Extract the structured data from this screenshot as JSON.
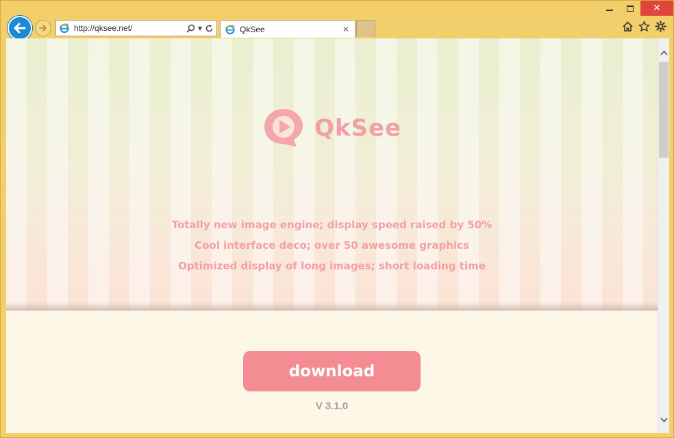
{
  "browser": {
    "address": "http://qksee.net/",
    "tab_title": "QkSee",
    "tab_close": "✕",
    "window": {
      "minimize": "minimize",
      "maximize": "maximize",
      "close": "✕"
    }
  },
  "page": {
    "logo_text": "QkSee",
    "features": [
      "Totally new image engine; display speed raised by 50%",
      "Cool interface deco; over 50 awesome graphics",
      "Optimized display of long images; short loading time"
    ],
    "download_label": "download",
    "version": "V 3.1.0"
  },
  "colors": {
    "brand_pink": "#f2a0a4",
    "button_pink": "#f38c93",
    "frame": "#f3cf6b",
    "back_button": "#1a8ad4",
    "close_button": "#e0453a"
  },
  "icons": [
    "back-arrow-icon",
    "forward-arrow-icon",
    "ie-icon",
    "search-icon",
    "refresh-icon",
    "home-icon",
    "star-icon",
    "gear-icon",
    "play-bubble-icon"
  ]
}
